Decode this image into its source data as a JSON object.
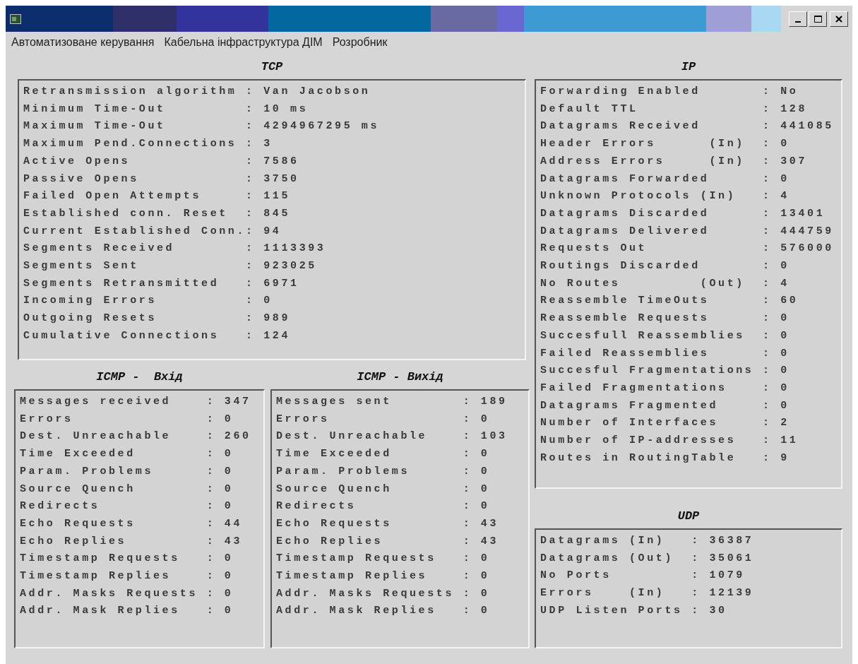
{
  "menu": [
    "Автоматизоване керування",
    "Кабельна інфраструктура ДІМ",
    "Розробник"
  ],
  "tcp": {
    "title": "TCP",
    "lines": [
      "Retransmission algorithm : Van Jacobson",
      "Minimum Time-Out         : 10 ms",
      "Maximum Time-Out         : 4294967295 ms",
      "Maximum Pend.Connections : 3",
      "Active Opens             : 7586",
      "Passive Opens            : 3750",
      "Failed Open Attempts     : 115",
      "Established conn. Reset  : 845",
      "Current Established Conn.: 94",
      "Segments Received        : 1113393",
      "Segments Sent            : 923025",
      "Segments Retransmitted   : 6971",
      "Incoming Errors          : 0",
      "Outgoing Resets          : 989",
      "Cumulative Connections   : 124"
    ]
  },
  "icmp_in": {
    "title": "ICMP -  Вхід",
    "lines": [
      "Messages received    : 347",
      "Errors               : 0",
      "Dest. Unreachable    : 260",
      "Time Exceeded        : 0",
      "Param. Problems      : 0",
      "Source Quench        : 0",
      "Redirects            : 0",
      "Echo Requests        : 44",
      "Echo Replies         : 43",
      "Timestamp Requests   : 0",
      "Timestamp Replies    : 0",
      "Addr. Masks Requests : 0",
      "Addr. Mask Replies   : 0"
    ]
  },
  "icmp_out": {
    "title": "ICMP - Вихід",
    "lines": [
      "Messages sent        : 189",
      "Errors               : 0",
      "Dest. Unreachable    : 103",
      "Time Exceeded        : 0",
      "Param. Problems      : 0",
      "Source Quench        : 0",
      "Redirects            : 0",
      "Echo Requests        : 43",
      "Echo Replies         : 43",
      "Timestamp Requests   : 0",
      "Timestamp Replies    : 0",
      "Addr. Masks Requests : 0",
      "Addr. Mask Replies   : 0"
    ]
  },
  "ip": {
    "title": "IP",
    "lines": [
      "Forwarding Enabled       : No",
      "Default TTL              : 128",
      "Datagrams Received       : 441085",
      "Header Errors      (In)  : 0",
      "Address Errors     (In)  : 307",
      "Datagrams Forwarded      : 0",
      "Unknown Protocols (In)   : 4",
      "Datagrams Discarded      : 13401",
      "Datagrams Delivered      : 444759",
      "Requests Out             : 576000",
      "Routings Discarded       : 0",
      "No Routes         (Out)  : 4",
      "Reassemble TimeOuts      : 60",
      "Reassemble Requests      : 0",
      "Succesfull Reassemblies  : 0",
      "Failed Reassemblies      : 0",
      "Succesful Fragmentations : 0",
      "Failed Fragmentations    : 0",
      "Datagrams Fragmented     : 0",
      "Number of Interfaces     : 2",
      "Number of IP-addresses   : 11",
      "Routes in RoutingTable   : 9"
    ]
  },
  "udp": {
    "title": "UDP",
    "lines": [
      "Datagrams (In)   : 36387",
      "Datagrams (Out)  : 35061",
      "No Ports         : 1079",
      "Errors    (In)   : 12139",
      "UDP Listen Ports : 30"
    ]
  }
}
